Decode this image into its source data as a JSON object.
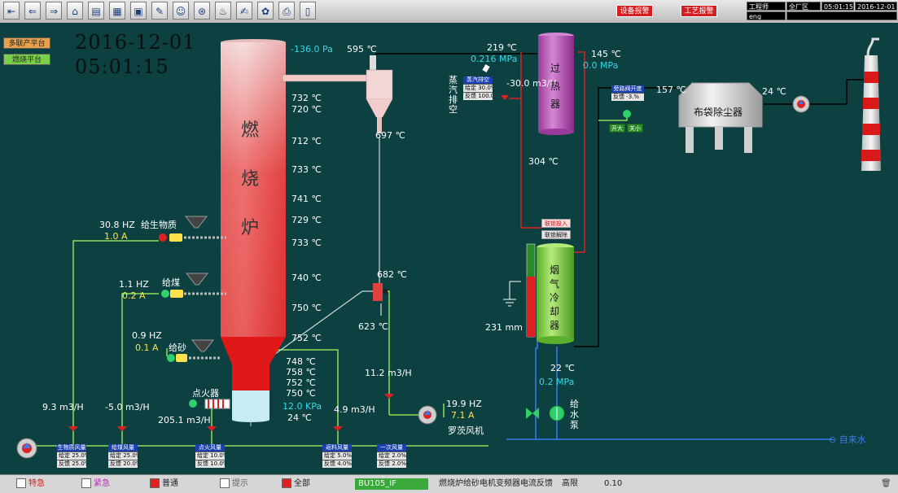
{
  "toolbar": {
    "buttons": [
      "nav-first",
      "nav-back",
      "nav-forward",
      "home",
      "screen-1",
      "screen-2",
      "screen-3",
      "tools",
      "users",
      "valve",
      "process",
      "log",
      "settings",
      "print",
      "exit"
    ],
    "device_alarm": "设备报警",
    "process_alarm": "工艺报警",
    "status": {
      "role": "工程师",
      "area": "全厂区",
      "time": "05:01:15",
      "date": "2016-12-01",
      "user": "eng"
    }
  },
  "platforms": {
    "multi": "多联产平台",
    "combustion": "燃烧平台"
  },
  "datetime": {
    "date": "2016-12-01",
    "time": "05:01:15"
  },
  "furnace": {
    "title_1": "燃",
    "title_2": "烧",
    "title_3": "炉",
    "pressure": "-136.0 Pa",
    "temps": [
      "732 ℃",
      "720 ℃",
      "712 ℃",
      "733 ℃",
      "741 ℃",
      "729 ℃",
      "733 ℃",
      "740 ℃",
      "750 ℃",
      "752 ℃"
    ],
    "bottom_temps": [
      "748 ℃",
      "758 ℃",
      "752 ℃",
      "750 ℃"
    ],
    "bottom_pressure": "12.0 KPa",
    "bottom_temp": "24 ℃"
  },
  "cyclone": {
    "temp_top": "595 ℃",
    "temp_mid": "697 ℃",
    "temp_valve": "682 ℃",
    "temp_low": "623 ℃"
  },
  "feeders": {
    "biomass": {
      "name": "给生物质",
      "hz": "30.8 HZ",
      "amp": "1.0 A"
    },
    "coal": {
      "name": "给煤",
      "hz": "1.1 HZ",
      "amp": "0.2 A"
    },
    "sand": {
      "name": "给砂",
      "hz": "0.9 HZ",
      "amp": "0.1 A"
    }
  },
  "igniter": "点火器",
  "flows": {
    "f1": "9.3 m3/H",
    "f2": "-5.0 m3/H",
    "f3": "205.1 m3/H",
    "f4": "4.9 m3/H",
    "f5": "11.2 m3/H",
    "steam": "-30.0 m3/H"
  },
  "roots_fan": {
    "name": "罗茨风机",
    "hz": "19.9 HZ",
    "amp": "7.1 A"
  },
  "superheater": {
    "name_1": "过",
    "name_2": "热",
    "name_3": "器",
    "temp_in": "219 ℃",
    "press_in": "0.216 MPa",
    "temp_out": "145 ℃",
    "press_out": "0.0 MPa",
    "temp_bottom": "304 ℃"
  },
  "steam_vent": {
    "label_1": "蒸",
    "label_2": "汽",
    "label_3": "排",
    "label_4": "空",
    "box": {
      "title": "蒸汽排空",
      "r1": "给定 30.0%",
      "r2": "反馈 100.0%"
    }
  },
  "cooler": {
    "name_1": "烟",
    "name_2": "气",
    "name_3": "冷",
    "name_4": "却",
    "name_5": "器",
    "level": "231 mm",
    "level_pct": 0.65,
    "btn_on": "联锁投入",
    "btn_off": "联锁解除"
  },
  "water_pump": {
    "name_1": "给",
    "name_2": "水",
    "name_3": "泵",
    "temp": "22 ℃",
    "press": "0.2 MPa",
    "arrow_text": "自来水"
  },
  "bag_filter": {
    "name": "布袋除尘器",
    "temp_in": "157 ℃",
    "temp_out": "24 ℃"
  },
  "bypass_valve": {
    "title": "旁路阀开度",
    "row": "反馈 -3.%",
    "open": "开大",
    "close": "关小"
  },
  "valve_boxes": [
    {
      "title": "生物质风量",
      "r1": "给定 25.0%",
      "r2": "反馈 25.0%"
    },
    {
      "title": "给煤风量",
      "r1": "给定 25.0%",
      "r2": "反馈 20.0%"
    },
    {
      "title": "点火风量",
      "r1": "给定 10.0%",
      "r2": "反馈 10.0%"
    },
    {
      "title": "返料风量",
      "r1": "给定 5.0%",
      "r2": "反馈 4.0%"
    },
    {
      "title": "一次风量",
      "r1": "给定 2.0%",
      "r2": "反馈 2.0%"
    }
  ],
  "statusbar": {
    "f_urgent": "特急",
    "f_emergency": "紧急",
    "f_normal": "普通",
    "f_hint": "提示",
    "f_all": "全部",
    "tag": "BU105_IF",
    "desc": "燃烧炉给砂电机变频器电流反馈",
    "level": "高限",
    "value": "0.10"
  },
  "colors": {
    "bg": "#0d4141",
    "accent_red": "#e02020",
    "line_green": "#8ee05a",
    "line_blue": "#3a7cf0"
  }
}
